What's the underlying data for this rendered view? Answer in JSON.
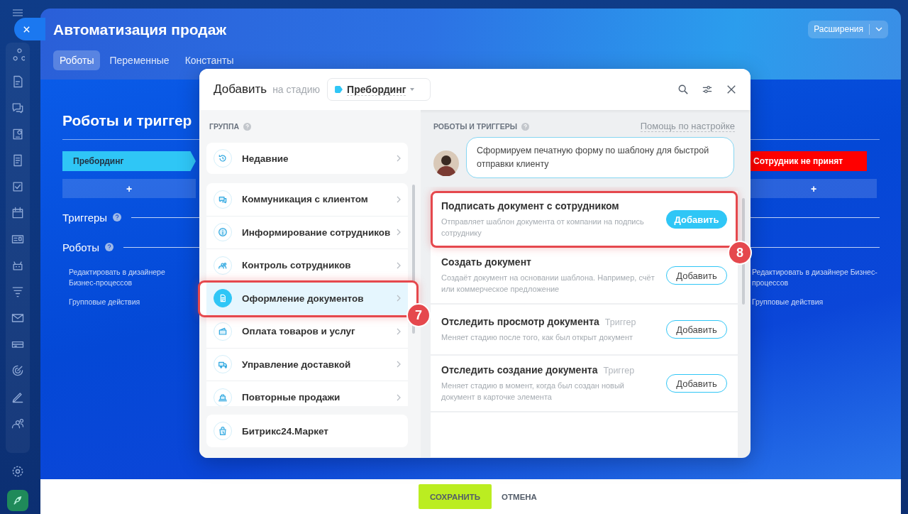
{
  "app": {
    "title": "Автоматизация продаж",
    "extensions_button": "Расширения",
    "tabs": [
      {
        "label": "Роботы",
        "selected": true
      },
      {
        "label": "Переменные",
        "selected": false
      },
      {
        "label": "Константы",
        "selected": false
      }
    ]
  },
  "board": {
    "title": "Роботы и триггер",
    "columns": [
      {
        "stage": "Пребординг",
        "color": "#2fc6f6",
        "add": "+",
        "triggers_label": "Триггеры",
        "robots_label": "Роботы",
        "links": [
          "Редактировать в дизайнере Бизнес-процессов",
          "Групповые действия"
        ]
      },
      {
        "stage": "Сотрудник не принят",
        "color": "#ff0000",
        "add": "+",
        "links": [
          "Редактировать в дизайнере Бизнес-процессов",
          "Групповые действия"
        ]
      }
    ]
  },
  "modal": {
    "title": "Добавить",
    "stage_prefix": "на стадию",
    "stage": {
      "name": "Пребординг",
      "color": "#2fc6f6"
    },
    "groups_header": "ГРУППА",
    "recent": {
      "label": "Недавние"
    },
    "groups": [
      {
        "label": "Коммуникация с клиентом",
        "selected": false
      },
      {
        "label": "Информирование сотрудников",
        "selected": false
      },
      {
        "label": "Контроль сотрудников",
        "selected": false
      },
      {
        "label": "Оформление документов",
        "selected": true,
        "callout": "7"
      },
      {
        "label": "Оплата товаров и услуг",
        "selected": false
      },
      {
        "label": "Управление доставкой",
        "selected": false
      },
      {
        "label": "Повторные продажи",
        "selected": false
      }
    ],
    "market": {
      "label": "Битрикс24.Маркет"
    },
    "robots_header": "РОБОТЫ И ТРИГГЕРЫ",
    "help_link": "Помощь по настройке",
    "hint": "Сформируем печатную форму по шаблону для быстрой отправки клиенту",
    "robots": [
      {
        "title": "Подписать документ с сотрудником",
        "description": "Отправляет шаблон документа от компании на подпись сотруднику",
        "button": "Добавить",
        "primary": true,
        "callout": "8"
      },
      {
        "title": "Создать документ",
        "description": "Создаёт документ на основании шаблона. Например, счёт или коммерческое предложение",
        "button": "Добавить",
        "primary": false
      },
      {
        "title": "Отследить просмотр документа",
        "tag": "Триггер",
        "description": "Меняет стадию после того, как был открыт документ",
        "button": "Добавить",
        "primary": false
      },
      {
        "title": "Отследить создание документа",
        "tag": "Триггер",
        "description": "Меняет стадию в момент, когда был создан новый документ в карточке элемента",
        "button": "Добавить",
        "primary": false
      }
    ]
  },
  "footer": {
    "save": "СОХРАНИТЬ",
    "cancel": "ОТМЕНА"
  }
}
